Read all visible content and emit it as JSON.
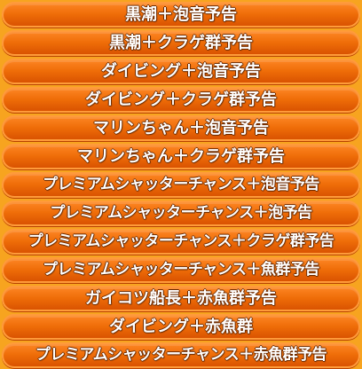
{
  "menu": {
    "items": [
      "黒潮＋泡音予告",
      "黒潮＋クラゲ群予告",
      "ダイビング＋泡音予告",
      "ダイビング＋クラゲ群予告",
      "マリンちゃん＋泡音予告",
      "マリンちゃん＋クラゲ群予告",
      "プレミアムシャッターチャンス＋泡音予告",
      "プレミアムシャッターチャンス＋泡予告",
      "プレミアムシャッターチャンス＋クラゲ群予告",
      "プレミアムシャッターチャンス＋魚群予告",
      "ガイコツ船長＋赤魚群予告",
      "ダイビング＋赤魚群",
      "プレミアムシャッターチャンス＋赤魚群予告"
    ]
  },
  "colors": {
    "background": "#f7a41f",
    "button_top": "#ff8a28",
    "button_bottom": "#d64f00",
    "label": "#ffffff",
    "label_outline": "#6b2a00"
  }
}
